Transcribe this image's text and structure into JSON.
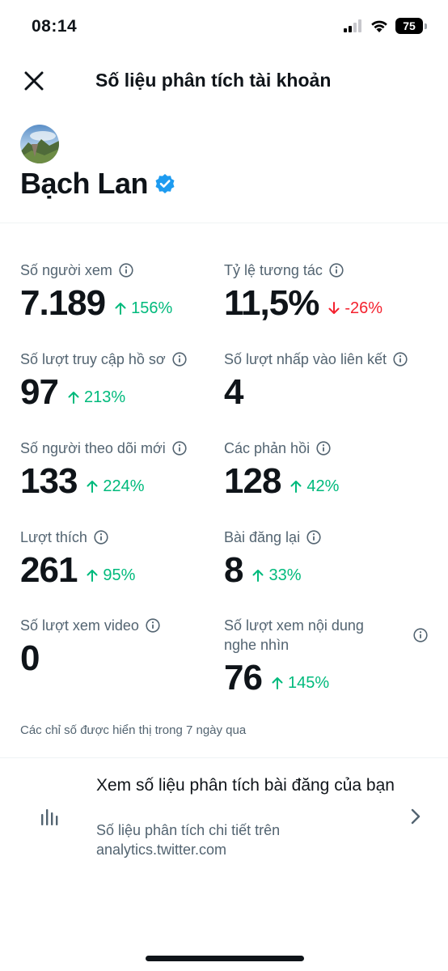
{
  "status_bar": {
    "time": "08:14",
    "battery": "75"
  },
  "nav": {
    "title": "Số liệu phân tích tài khoản"
  },
  "profile": {
    "name": "Bạch Lan"
  },
  "metrics": [
    {
      "label": "Số người xem",
      "value": "7.189",
      "change": "156%",
      "direction": "up"
    },
    {
      "label": "Tỷ lệ tương tác",
      "value": "11,5%",
      "change": "-26%",
      "direction": "down"
    },
    {
      "label": "Số lượt truy cập hồ sơ",
      "value": "97",
      "change": "213%",
      "direction": "up"
    },
    {
      "label": "Số lượt nhấp vào liên kết",
      "value": "4",
      "change": "",
      "direction": "none"
    },
    {
      "label": "Số người theo dõi mới",
      "value": "133",
      "change": "224%",
      "direction": "up"
    },
    {
      "label": "Các phản hồi",
      "value": "128",
      "change": "42%",
      "direction": "up"
    },
    {
      "label": "Lượt thích",
      "value": "261",
      "change": "95%",
      "direction": "up"
    },
    {
      "label": "Bài đăng lại",
      "value": "8",
      "change": "33%",
      "direction": "up"
    },
    {
      "label": "Số lượt xem video",
      "value": "0",
      "change": "",
      "direction": "none"
    },
    {
      "label_line1": "Số lượt xem nội dung",
      "label_line2": "nghe nhìn",
      "value": "76",
      "change": "145%",
      "direction": "up"
    }
  ],
  "footnote": "Các chỉ số được hiển thị trong 7 ngày qua",
  "post_analytics_link": {
    "title": "Xem số liệu phân tích bài đăng của bạn",
    "subtitle": "Số liệu phân tích chi tiết trên analytics.twitter.com"
  },
  "colors": {
    "positive": "#00ba7c",
    "negative": "#f4212e",
    "verified": "#1d9bf0",
    "secondary_text": "#536471"
  }
}
